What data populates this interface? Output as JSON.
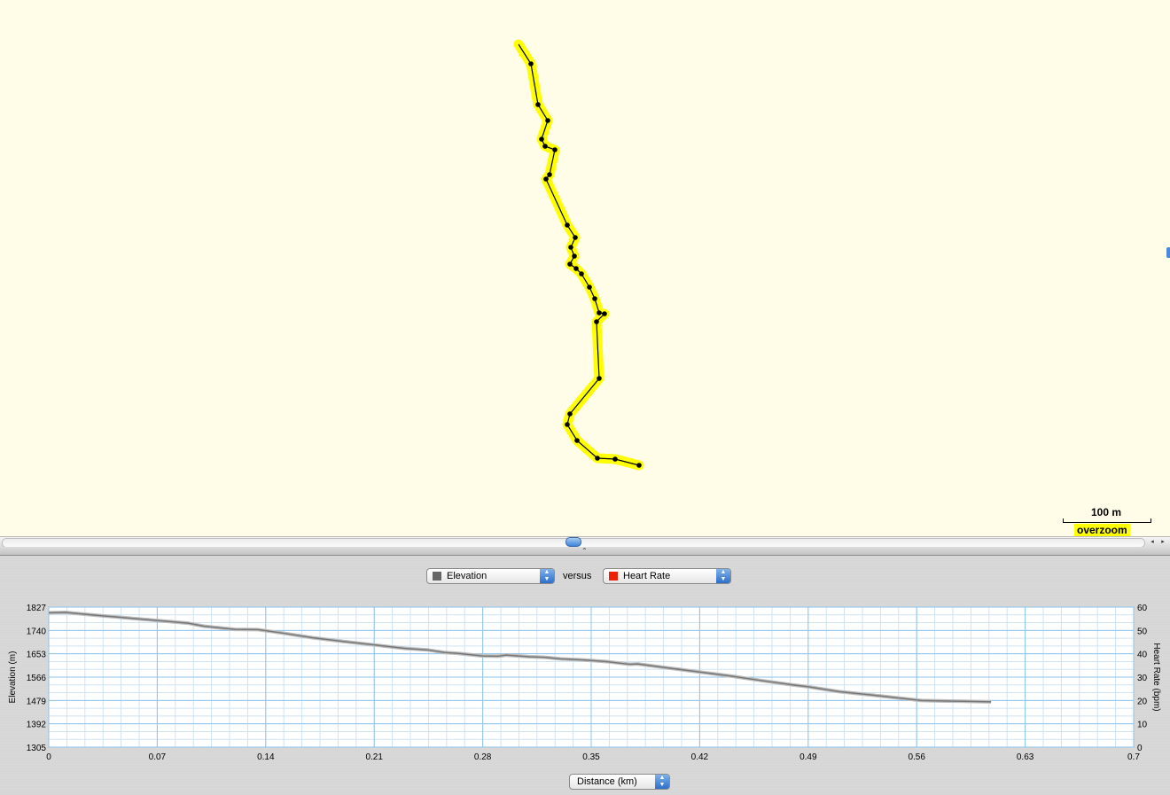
{
  "map": {
    "scale_label": "100 m",
    "overzoom_label": "overzoom",
    "track_color": "#ffff00",
    "track_line_color": "#000000"
  },
  "scrollbar": {
    "left_arrow": "◂",
    "right_arrow": "▸"
  },
  "splitter_grip": "⌃",
  "controls": {
    "y1_select": {
      "value": "Elevation",
      "swatch": "#666666"
    },
    "versus_label": "versus",
    "y2_select": {
      "value": "Heart Rate",
      "swatch": "#ee2200"
    },
    "x_select": {
      "value": "Distance (km)"
    }
  },
  "chart_data": {
    "type": "line",
    "xlabel": "Distance (km)",
    "ylabel": "Elevation (m)",
    "y2label": "Heart Rate (bpm)",
    "xlim": [
      0,
      0.7
    ],
    "ylim": [
      1305,
      1827
    ],
    "y2lim": [
      0,
      60
    ],
    "x_ticks": [
      "0",
      "0.07",
      "0.14",
      "0.21",
      "0.28",
      "0.35",
      "0.42",
      "0.49",
      "0.56",
      "0.63",
      "0.7"
    ],
    "y_ticks": [
      "1305",
      "1392",
      "1479",
      "1566",
      "1653",
      "1740",
      "1827"
    ],
    "y2_ticks": [
      "0",
      "10",
      "20",
      "30",
      "40",
      "50",
      "60"
    ],
    "grid": true,
    "series": [
      {
        "color": "#777777",
        "x": [
          0,
          0.011,
          0.03,
          0.05,
          0.07,
          0.09,
          0.1,
          0.12,
          0.135,
          0.15,
          0.17,
          0.19,
          0.21,
          0.23,
          0.245,
          0.255,
          0.265,
          0.28,
          0.29,
          0.295,
          0.31,
          0.32,
          0.33,
          0.345,
          0.36,
          0.37,
          0.375,
          0.38,
          0.4,
          0.42,
          0.44,
          0.46,
          0.48,
          0.49,
          0.51,
          0.53,
          0.55,
          0.563,
          0.58,
          0.59,
          0.608
        ],
        "y": [
          1806,
          1807,
          1797,
          1787,
          1777,
          1767,
          1756,
          1744,
          1743,
          1731,
          1713,
          1699,
          1686,
          1673,
          1667,
          1658,
          1654,
          1645,
          1644,
          1648,
          1642,
          1640,
          1634,
          1630,
          1624,
          1617,
          1614,
          1615,
          1600,
          1585,
          1570,
          1553,
          1537,
          1530,
          1512,
          1500,
          1487,
          1479,
          1477,
          1476,
          1474
        ]
      }
    ]
  }
}
